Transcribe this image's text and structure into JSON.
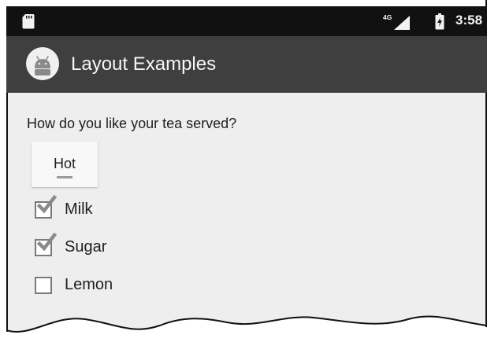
{
  "status_bar": {
    "time": "3:58",
    "network_label": "4G",
    "icons": [
      "sd-card-icon",
      "cell-signal-icon",
      "battery-charging-icon"
    ]
  },
  "app_bar": {
    "title": "Layout Examples",
    "icon": "android-icon"
  },
  "content": {
    "question": "How do you like your tea served?",
    "spinner": {
      "selected": "Hot"
    },
    "checkboxes": [
      {
        "label": "Milk",
        "checked": true
      },
      {
        "label": "Sugar",
        "checked": true
      },
      {
        "label": "Lemon",
        "checked": false
      }
    ]
  },
  "colors": {
    "status_bar": "#111111",
    "app_bar": "#3f3f3f",
    "content_bg": "#eeeeee",
    "text": "#1e1e1e",
    "check_mark": "#8a8a8a"
  }
}
